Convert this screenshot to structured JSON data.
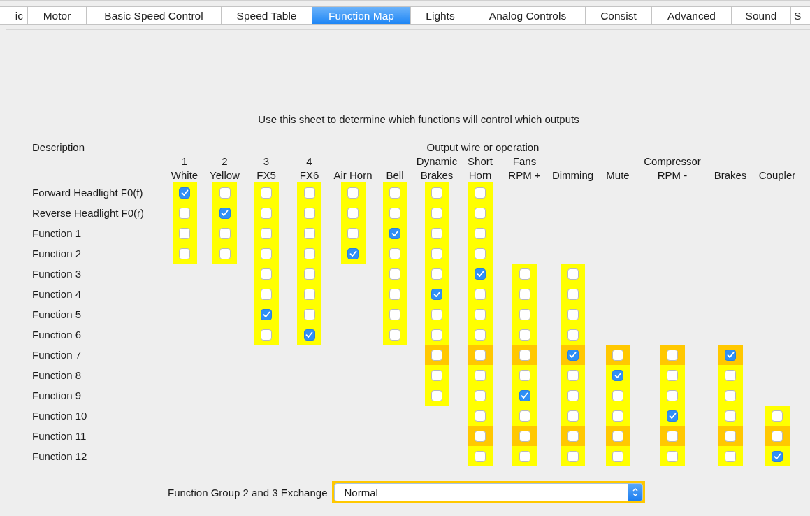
{
  "tabs": [
    {
      "label": "ic",
      "selected": false
    },
    {
      "label": "Motor",
      "selected": false
    },
    {
      "label": "Basic Speed Control",
      "selected": false
    },
    {
      "label": "Speed Table",
      "selected": false
    },
    {
      "label": "Function Map",
      "selected": true
    },
    {
      "label": "Lights",
      "selected": false
    },
    {
      "label": "Analog Controls",
      "selected": false
    },
    {
      "label": "Consist",
      "selected": false
    },
    {
      "label": "Advanced",
      "selected": false
    },
    {
      "label": "Sound",
      "selected": false
    },
    {
      "label": "S",
      "selected": false
    }
  ],
  "instruction": "Use this sheet to determine which functions will control which outputs",
  "description_heading": "Description",
  "outputs_heading": "Output wire or operation",
  "columns": [
    {
      "lines": [
        "1",
        "White"
      ]
    },
    {
      "lines": [
        "2",
        "Yellow"
      ]
    },
    {
      "lines": [
        "3",
        "FX5"
      ]
    },
    {
      "lines": [
        "4",
        "FX6"
      ]
    },
    {
      "lines": [
        "Air Horn"
      ]
    },
    {
      "lines": [
        "Bell"
      ]
    },
    {
      "lines": [
        "Dynamic",
        "Brakes"
      ]
    },
    {
      "lines": [
        "Short",
        "Horn"
      ]
    },
    {
      "lines": [
        "Fans",
        "RPM +"
      ]
    },
    {
      "lines": [
        "Dimming"
      ]
    },
    {
      "lines": [
        "Mute"
      ]
    },
    {
      "lines": [
        "Compressor",
        "RPM -"
      ]
    },
    {
      "lines": [
        "Brakes"
      ]
    },
    {
      "lines": [
        "Coupler"
      ]
    }
  ],
  "rows": [
    {
      "label": "Forward Headlight F0(f)",
      "cells": [
        {
          "kind": "yellow",
          "checked": true
        },
        {
          "kind": "yellow",
          "checked": false
        },
        {
          "kind": "yellow",
          "checked": false
        },
        {
          "kind": "yellow",
          "checked": false
        },
        {
          "kind": "yellow",
          "checked": false
        },
        {
          "kind": "yellow",
          "checked": false
        },
        {
          "kind": "yellow",
          "checked": false
        },
        {
          "kind": "yellow",
          "checked": false
        },
        {
          "kind": "none"
        },
        {
          "kind": "none"
        },
        {
          "kind": "none"
        },
        {
          "kind": "none"
        },
        {
          "kind": "none"
        },
        {
          "kind": "none"
        }
      ]
    },
    {
      "label": "Reverse Headlight F0(r)",
      "cells": [
        {
          "kind": "yellow",
          "checked": false
        },
        {
          "kind": "yellow",
          "checked": true
        },
        {
          "kind": "yellow",
          "checked": false
        },
        {
          "kind": "yellow",
          "checked": false
        },
        {
          "kind": "yellow",
          "checked": false
        },
        {
          "kind": "yellow",
          "checked": false
        },
        {
          "kind": "yellow",
          "checked": false
        },
        {
          "kind": "yellow",
          "checked": false
        },
        {
          "kind": "none"
        },
        {
          "kind": "none"
        },
        {
          "kind": "none"
        },
        {
          "kind": "none"
        },
        {
          "kind": "none"
        },
        {
          "kind": "none"
        }
      ]
    },
    {
      "label": "Function 1",
      "cells": [
        {
          "kind": "yellow",
          "checked": false
        },
        {
          "kind": "yellow",
          "checked": false
        },
        {
          "kind": "yellow",
          "checked": false
        },
        {
          "kind": "yellow",
          "checked": false
        },
        {
          "kind": "yellow",
          "checked": false
        },
        {
          "kind": "yellow",
          "checked": true
        },
        {
          "kind": "yellow",
          "checked": false
        },
        {
          "kind": "yellow",
          "checked": false
        },
        {
          "kind": "none"
        },
        {
          "kind": "none"
        },
        {
          "kind": "none"
        },
        {
          "kind": "none"
        },
        {
          "kind": "none"
        },
        {
          "kind": "none"
        }
      ]
    },
    {
      "label": "Function 2",
      "cells": [
        {
          "kind": "yellow",
          "checked": false
        },
        {
          "kind": "yellow",
          "checked": false
        },
        {
          "kind": "yellow",
          "checked": false
        },
        {
          "kind": "yellow",
          "checked": false
        },
        {
          "kind": "yellow",
          "checked": true
        },
        {
          "kind": "yellow",
          "checked": false
        },
        {
          "kind": "yellow",
          "checked": false
        },
        {
          "kind": "yellow",
          "checked": false
        },
        {
          "kind": "none"
        },
        {
          "kind": "none"
        },
        {
          "kind": "none"
        },
        {
          "kind": "none"
        },
        {
          "kind": "none"
        },
        {
          "kind": "none"
        }
      ]
    },
    {
      "label": "Function 3",
      "cells": [
        {
          "kind": "none"
        },
        {
          "kind": "none"
        },
        {
          "kind": "yellow",
          "checked": false
        },
        {
          "kind": "yellow",
          "checked": false
        },
        {
          "kind": "none"
        },
        {
          "kind": "yellow",
          "checked": false
        },
        {
          "kind": "yellow",
          "checked": false
        },
        {
          "kind": "yellow",
          "checked": true
        },
        {
          "kind": "yellow",
          "checked": false
        },
        {
          "kind": "yellow",
          "checked": false
        },
        {
          "kind": "none"
        },
        {
          "kind": "none"
        },
        {
          "kind": "none"
        },
        {
          "kind": "none"
        }
      ]
    },
    {
      "label": "Function 4",
      "cells": [
        {
          "kind": "none"
        },
        {
          "kind": "none"
        },
        {
          "kind": "yellow",
          "checked": false
        },
        {
          "kind": "yellow",
          "checked": false
        },
        {
          "kind": "none"
        },
        {
          "kind": "yellow",
          "checked": false
        },
        {
          "kind": "yellow",
          "checked": true
        },
        {
          "kind": "yellow",
          "checked": false
        },
        {
          "kind": "yellow",
          "checked": false
        },
        {
          "kind": "yellow",
          "checked": false
        },
        {
          "kind": "none"
        },
        {
          "kind": "none"
        },
        {
          "kind": "none"
        },
        {
          "kind": "none"
        }
      ]
    },
    {
      "label": "Function 5",
      "cells": [
        {
          "kind": "none"
        },
        {
          "kind": "none"
        },
        {
          "kind": "yellow",
          "checked": true
        },
        {
          "kind": "yellow",
          "checked": false
        },
        {
          "kind": "none"
        },
        {
          "kind": "yellow",
          "checked": false
        },
        {
          "kind": "yellow",
          "checked": false
        },
        {
          "kind": "yellow",
          "checked": false
        },
        {
          "kind": "yellow",
          "checked": false
        },
        {
          "kind": "yellow",
          "checked": false
        },
        {
          "kind": "none"
        },
        {
          "kind": "none"
        },
        {
          "kind": "none"
        },
        {
          "kind": "none"
        }
      ]
    },
    {
      "label": "Function 6",
      "cells": [
        {
          "kind": "none"
        },
        {
          "kind": "none"
        },
        {
          "kind": "yellow",
          "checked": false
        },
        {
          "kind": "yellow",
          "checked": true
        },
        {
          "kind": "none"
        },
        {
          "kind": "yellow",
          "checked": false
        },
        {
          "kind": "yellow",
          "checked": false
        },
        {
          "kind": "yellow",
          "checked": false
        },
        {
          "kind": "yellow",
          "checked": false
        },
        {
          "kind": "yellow",
          "checked": false
        },
        {
          "kind": "none"
        },
        {
          "kind": "none"
        },
        {
          "kind": "none"
        },
        {
          "kind": "none"
        }
      ]
    },
    {
      "label": "Function 7",
      "cells": [
        {
          "kind": "none"
        },
        {
          "kind": "none"
        },
        {
          "kind": "none"
        },
        {
          "kind": "none"
        },
        {
          "kind": "none"
        },
        {
          "kind": "none"
        },
        {
          "kind": "orange",
          "checked": false
        },
        {
          "kind": "orange",
          "checked": false
        },
        {
          "kind": "orange",
          "checked": false
        },
        {
          "kind": "orange",
          "checked": true
        },
        {
          "kind": "orange",
          "checked": false
        },
        {
          "kind": "orange",
          "checked": false
        },
        {
          "kind": "orange",
          "checked": true
        },
        {
          "kind": "none"
        }
      ]
    },
    {
      "label": "Function 8",
      "cells": [
        {
          "kind": "none"
        },
        {
          "kind": "none"
        },
        {
          "kind": "none"
        },
        {
          "kind": "none"
        },
        {
          "kind": "none"
        },
        {
          "kind": "none"
        },
        {
          "kind": "yellow",
          "checked": false
        },
        {
          "kind": "yellow",
          "checked": false
        },
        {
          "kind": "yellow",
          "checked": false
        },
        {
          "kind": "yellow",
          "checked": false
        },
        {
          "kind": "yellow",
          "checked": true
        },
        {
          "kind": "yellow",
          "checked": false
        },
        {
          "kind": "yellow",
          "checked": false
        },
        {
          "kind": "none"
        }
      ]
    },
    {
      "label": "Function 9",
      "cells": [
        {
          "kind": "none"
        },
        {
          "kind": "none"
        },
        {
          "kind": "none"
        },
        {
          "kind": "none"
        },
        {
          "kind": "none"
        },
        {
          "kind": "none"
        },
        {
          "kind": "yellow",
          "checked": false
        },
        {
          "kind": "yellow",
          "checked": false
        },
        {
          "kind": "yellow",
          "checked": true
        },
        {
          "kind": "yellow",
          "checked": false
        },
        {
          "kind": "yellow",
          "checked": false
        },
        {
          "kind": "yellow",
          "checked": false
        },
        {
          "kind": "yellow",
          "checked": false
        },
        {
          "kind": "none"
        }
      ]
    },
    {
      "label": "Function 10",
      "cells": [
        {
          "kind": "none"
        },
        {
          "kind": "none"
        },
        {
          "kind": "none"
        },
        {
          "kind": "none"
        },
        {
          "kind": "none"
        },
        {
          "kind": "none"
        },
        {
          "kind": "none"
        },
        {
          "kind": "yellow",
          "checked": false
        },
        {
          "kind": "yellow",
          "checked": false
        },
        {
          "kind": "yellow",
          "checked": false
        },
        {
          "kind": "yellow",
          "checked": false
        },
        {
          "kind": "yellow",
          "checked": true
        },
        {
          "kind": "yellow",
          "checked": false
        },
        {
          "kind": "yellow",
          "checked": false
        }
      ]
    },
    {
      "label": "Function 11",
      "cells": [
        {
          "kind": "none"
        },
        {
          "kind": "none"
        },
        {
          "kind": "none"
        },
        {
          "kind": "none"
        },
        {
          "kind": "none"
        },
        {
          "kind": "none"
        },
        {
          "kind": "none"
        },
        {
          "kind": "orange",
          "checked": false
        },
        {
          "kind": "orange",
          "checked": false
        },
        {
          "kind": "orange",
          "checked": false
        },
        {
          "kind": "orange",
          "checked": false
        },
        {
          "kind": "orange",
          "checked": false
        },
        {
          "kind": "orange",
          "checked": false
        },
        {
          "kind": "orange",
          "checked": false
        }
      ]
    },
    {
      "label": "Function 12",
      "cells": [
        {
          "kind": "none"
        },
        {
          "kind": "none"
        },
        {
          "kind": "none"
        },
        {
          "kind": "none"
        },
        {
          "kind": "none"
        },
        {
          "kind": "none"
        },
        {
          "kind": "none"
        },
        {
          "kind": "yellow",
          "checked": false
        },
        {
          "kind": "yellow",
          "checked": false
        },
        {
          "kind": "yellow",
          "checked": false
        },
        {
          "kind": "yellow",
          "checked": false
        },
        {
          "kind": "yellow",
          "checked": false
        },
        {
          "kind": "yellow",
          "checked": false
        },
        {
          "kind": "yellow",
          "checked": true
        }
      ]
    }
  ],
  "exchange": {
    "label": "Function Group 2 and 3 Exchange",
    "value": "Normal"
  }
}
